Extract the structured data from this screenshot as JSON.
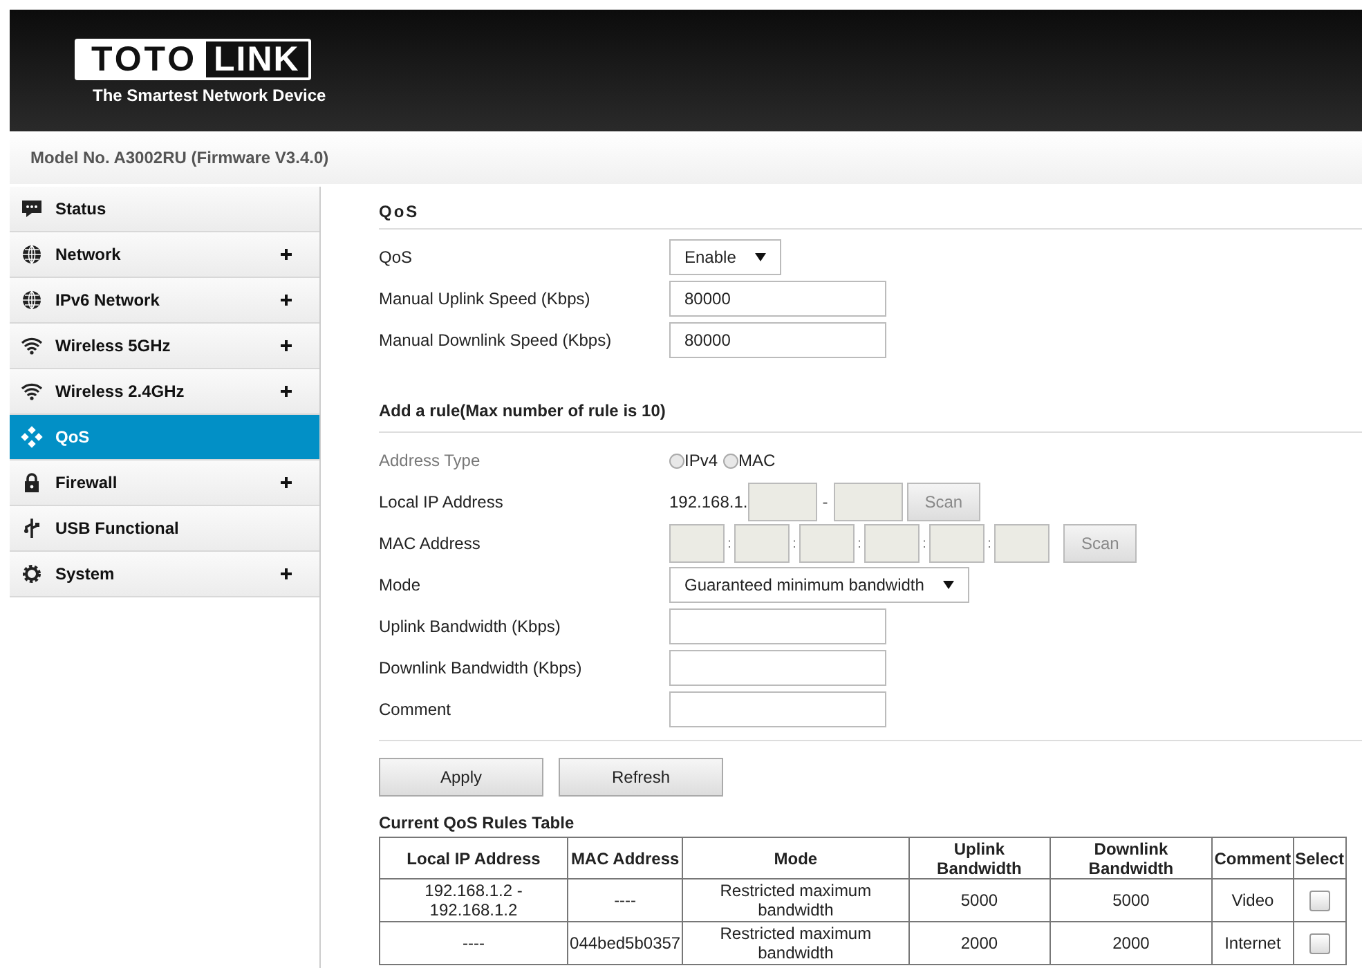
{
  "header": {
    "logo_left": "TOTO",
    "logo_right": "LINK",
    "tagline": "The Smartest Network Device"
  },
  "model": "Model No. A3002RU (Firmware V3.4.0)",
  "sidebar": {
    "items": [
      {
        "label": "Status",
        "kind": "chat",
        "expandable": false,
        "selected": false
      },
      {
        "label": "Network",
        "kind": "globe",
        "expandable": true,
        "selected": false
      },
      {
        "label": "IPv6 Network",
        "kind": "globe",
        "expandable": true,
        "selected": false
      },
      {
        "label": "Wireless 5GHz",
        "kind": "wifi",
        "expandable": true,
        "selected": false
      },
      {
        "label": "Wireless 2.4GHz",
        "kind": "wifi",
        "expandable": true,
        "selected": false
      },
      {
        "label": "QoS",
        "kind": "dots",
        "expandable": false,
        "selected": true
      },
      {
        "label": "Firewall",
        "kind": "lock",
        "expandable": true,
        "selected": false
      },
      {
        "label": "USB Functional",
        "kind": "usb",
        "expandable": false,
        "selected": false
      },
      {
        "label": "System",
        "kind": "gear",
        "expandable": true,
        "selected": false
      }
    ]
  },
  "sections": [
    {
      "title": "QoS",
      "rows": [
        {
          "kind": "select",
          "label": "QoS",
          "value": "Enable",
          "disabled": false
        },
        {
          "kind": "input",
          "label": "Manual Uplink Speed (Kbps)",
          "value": "80000",
          "disabled": false
        },
        {
          "kind": "input",
          "label": "Manual Downlink Speed (Kbps)",
          "value": "80000",
          "disabled": false
        }
      ]
    },
    {
      "title": "Add a rule(Max number of rule is 10)",
      "rows": [
        {
          "kind": "radio",
          "label": "Address Type",
          "disabled": true,
          "options": [
            {
              "label": "IPv4",
              "selected": false
            },
            {
              "label": "MAC",
              "selected": false
            }
          ]
        },
        {
          "kind": "ip_range",
          "label": "Local IP Address",
          "prefix": "192.168.1.",
          "separator": "-",
          "button": "Scan",
          "disabled": false
        },
        {
          "kind": "mac",
          "label": "MAC Address",
          "separator": ":",
          "button": "Scan",
          "disabled": false
        },
        {
          "kind": "select",
          "label": "Mode",
          "value": "Guaranteed minimum bandwidth",
          "disabled": false
        },
        {
          "kind": "input",
          "label": "Uplink Bandwidth (Kbps)",
          "disabled": false
        },
        {
          "kind": "input",
          "label": "Downlink Bandwidth (Kbps)",
          "disabled": false
        },
        {
          "kind": "input",
          "label": "Comment",
          "disabled": false
        }
      ]
    }
  ],
  "buttons": [
    "Apply",
    "Refresh"
  ],
  "table": {
    "title": "Current QoS Rules Table",
    "columns": [
      "Local IP Address",
      "MAC Address",
      "Mode",
      "Uplink Bandwidth",
      "Downlink Bandwidth",
      "Comment",
      "Select"
    ],
    "rows": [
      {
        "cells": [
          "192.168.1.2 - 192.168.1.2",
          "----",
          "Restricted maximum bandwidth",
          "5000",
          "5000",
          "Video"
        ],
        "selected": false
      },
      {
        "cells": [
          "----",
          "044bed5b0357",
          "Restricted maximum bandwidth",
          "2000",
          "2000",
          "Internet"
        ],
        "selected": false
      }
    ]
  }
}
